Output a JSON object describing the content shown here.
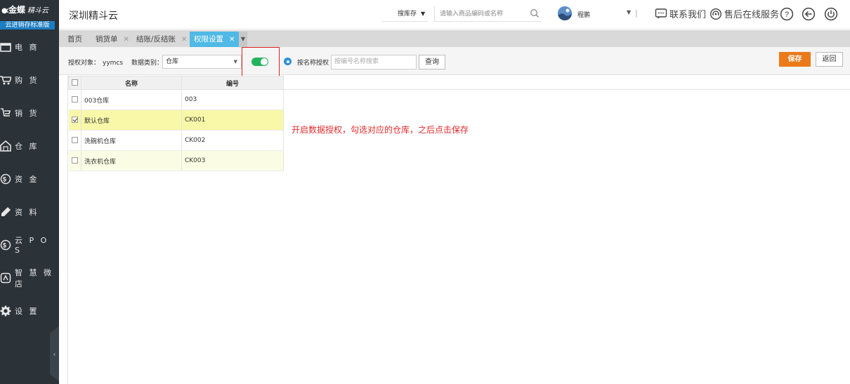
{
  "brand": {
    "name": "金蝶",
    "sub": "精斗云",
    "edition": "云进销存标准版"
  },
  "sidebar": {
    "items": [
      {
        "label": "电 商",
        "icon": "shop-icon"
      },
      {
        "label": "购 货",
        "icon": "cart-icon"
      },
      {
        "label": "销 货",
        "icon": "sales-icon"
      },
      {
        "label": "仓 库",
        "icon": "warehouse-icon"
      },
      {
        "label": "资 金",
        "icon": "dollar-icon"
      },
      {
        "label": "资 料",
        "icon": "pen-icon"
      },
      {
        "label": "云 P O S",
        "icon": "pos-icon"
      },
      {
        "label": "智 慧 微 店",
        "icon": "microstore-icon"
      },
      {
        "label": "设 置",
        "icon": "gear-icon"
      }
    ]
  },
  "header": {
    "company": "深圳精斗云",
    "search_scope": "搜库存",
    "search_placeholder": "请输入商品编码或名称",
    "user_name": "程鹏",
    "contact_label": "联系我们",
    "service_label": "售后在线服务"
  },
  "tabs": [
    {
      "label": "首页",
      "closable": false,
      "active": false
    },
    {
      "label": "销货单",
      "closable": true,
      "active": false
    },
    {
      "label": "结账/反结账",
      "closable": true,
      "active": false
    },
    {
      "label": "权限设置",
      "closable": true,
      "active": true
    }
  ],
  "toolbar": {
    "target_label": "授权对象：",
    "target_value": "yymcs",
    "type_label": "数据类别：",
    "type_value": "仓库",
    "authorize_by_name_label": "按名称授权",
    "search_placeholder": "按编号名称搜索",
    "query_label": "查询",
    "save_label": "保存",
    "back_label": "返回",
    "toggle_on": true
  },
  "grid": {
    "columns": [
      "名称",
      "编号"
    ],
    "rows": [
      {
        "name": "003仓库",
        "code": "003",
        "checked": false
      },
      {
        "name": "默认仓库",
        "code": "CK001",
        "checked": true
      },
      {
        "name": "洗碗机仓库",
        "code": "CK002",
        "checked": false
      },
      {
        "name": "洗衣机仓库",
        "code": "CK003",
        "checked": false
      }
    ]
  },
  "annotation": "开启数据授权，勾选对应的仓库，之后点击保存",
  "colors": {
    "accent": "#50b9e5",
    "save": "#ea7a1a",
    "toggle": "#23b35f",
    "annotation": "#e22b2b",
    "sidebar": "#2b3238"
  }
}
